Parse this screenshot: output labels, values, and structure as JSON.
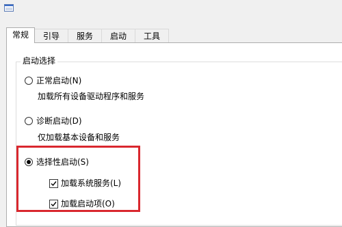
{
  "window": {
    "icon": "app-window-icon"
  },
  "tabs": [
    {
      "label": "常规",
      "active": true
    },
    {
      "label": "引导",
      "active": false
    },
    {
      "label": "服务",
      "active": false
    },
    {
      "label": "启动",
      "active": false
    },
    {
      "label": "工具",
      "active": false
    }
  ],
  "startup_group": {
    "title": "启动选择",
    "normal": {
      "label": "正常启动(N)",
      "desc": "加载所有设备驱动程序和服务",
      "checked": false
    },
    "diagnostic": {
      "label": "诊断启动(D)",
      "desc": "仅加载基本设备和服务",
      "checked": false
    },
    "selective": {
      "label": "选择性启动(S)",
      "checked": true,
      "load_services": {
        "label": "加载系统服务(L)",
        "checked": true
      },
      "load_startup": {
        "label": "加载启动项(O)",
        "checked": true
      }
    }
  },
  "colors": {
    "highlight": "#d9272e",
    "panel": "#ffffff",
    "window_bg": "#f0f0f0"
  }
}
